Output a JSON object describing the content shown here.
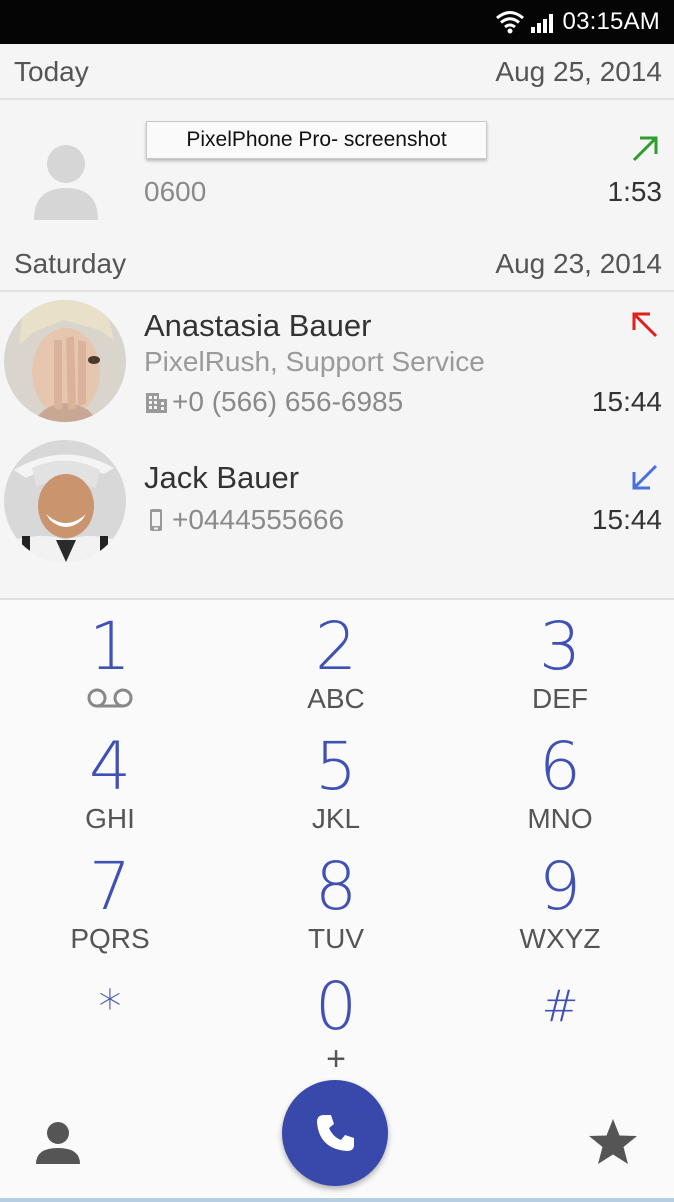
{
  "status_bar": {
    "time": "03:15AM",
    "icons": [
      "wifi-icon",
      "signal-icon"
    ]
  },
  "tooltip": "PixelPhone Pro- screenshot",
  "sections": [
    {
      "day": "Today",
      "date": "Aug 25, 2014",
      "calls": [
        {
          "name": "",
          "number": "0600",
          "duration": "1:53",
          "direction": "outgoing",
          "direction_color": "#2e9e2e",
          "avatar": "default-avatar-icon"
        }
      ]
    },
    {
      "day": "Saturday",
      "date": "Aug 23, 2014",
      "calls": [
        {
          "name": "Anastasia Bauer",
          "company": "PixelRush, Support Service",
          "number": "+0 (566) 656-6985",
          "number_type": "work-building-icon",
          "duration": "15:44",
          "direction": "missed",
          "direction_color": "#e0201c",
          "avatar": "photo"
        },
        {
          "name": "Jack Bauer",
          "number": "+0444555666",
          "number_type": "mobile-phone-icon",
          "duration": "15:44",
          "direction": "incoming",
          "direction_color": "#4a6fe0",
          "avatar": "photo"
        }
      ]
    }
  ],
  "keypad": [
    {
      "digit": "1",
      "letters": "",
      "icon": "voicemail-icon"
    },
    {
      "digit": "2",
      "letters": "ABC"
    },
    {
      "digit": "3",
      "letters": "DEF"
    },
    {
      "digit": "4",
      "letters": "GHI"
    },
    {
      "digit": "5",
      "letters": "JKL"
    },
    {
      "digit": "6",
      "letters": "MNO"
    },
    {
      "digit": "7",
      "letters": "PQRS"
    },
    {
      "digit": "8",
      "letters": "TUV"
    },
    {
      "digit": "9",
      "letters": "WXYZ"
    },
    {
      "digit": "*",
      "letters": ""
    },
    {
      "digit": "0",
      "letters": "+"
    },
    {
      "digit": "#",
      "letters": ""
    }
  ],
  "bottom_bar": {
    "left_icon": "contacts-icon",
    "center_icon": "phone-icon",
    "right_icon": "star-icon",
    "accent": "#3949ab"
  }
}
